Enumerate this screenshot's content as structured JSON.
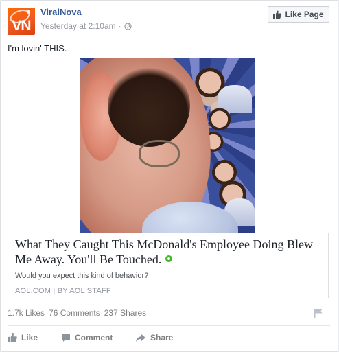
{
  "post": {
    "page_name": "ViralNova",
    "timestamp": "Yesterday at 2:10am",
    "avatar_text": "VN",
    "like_page_label": "Like Page",
    "status_text": "I'm lovin' THIS."
  },
  "link_preview": {
    "headline": "What They Caught This McDonald's Employee Doing Blew Me Away. You'll Be Touched.",
    "description": "Would you expect this kind of behavior?",
    "source": "AOL.COM",
    "author": "BY AOL STAFF"
  },
  "stats": {
    "likes": "1.7k Likes",
    "comments": "76 Comments",
    "shares": "237 Shares"
  },
  "actions": {
    "like_label": "Like",
    "comment_label": "Comment",
    "share_label": "Share"
  },
  "icons": {
    "thumbs_up": "thumbs-up-icon",
    "globe": "globe-icon",
    "comment": "comment-icon",
    "share": "share-icon",
    "flag": "flag-icon"
  },
  "colors": {
    "link_blue": "#365899",
    "brand_orange": "#f15a22",
    "muted_gray": "#7f7f7f",
    "green_accent": "#42b72a"
  }
}
